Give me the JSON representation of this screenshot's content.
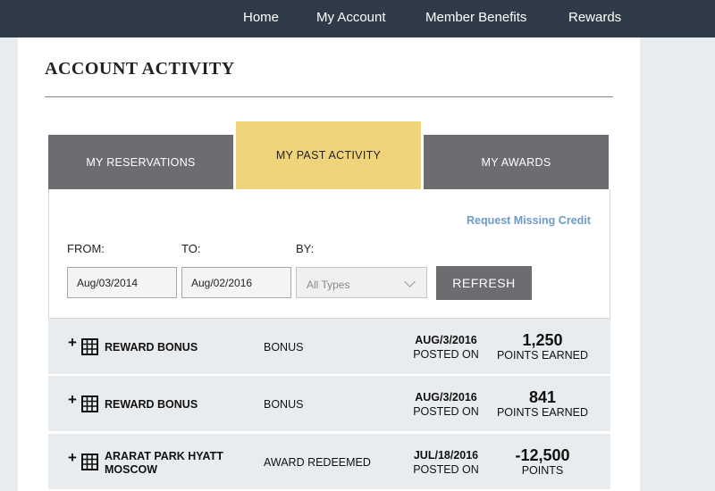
{
  "nav": {
    "items": [
      "Home",
      "My Account",
      "Member Benefits",
      "Rewards"
    ]
  },
  "page_title": "ACCOUNT ACTIVITY",
  "tabs": [
    {
      "label": "MY RESERVATIONS",
      "active": false
    },
    {
      "label": "MY PAST ACTIVITY",
      "active": true
    },
    {
      "label": "MY AWARDS",
      "active": false
    }
  ],
  "filters": {
    "request_link": "Request Missing Credit",
    "from_label": "FROM:",
    "to_label": "TO:",
    "by_label": "BY:",
    "from_value": "Aug/03/2014",
    "to_value": "Aug/02/2016",
    "by_value": "All Types",
    "refresh_label": "REFRESH"
  },
  "activity": [
    {
      "expand": "+",
      "icon": "building-icon",
      "name": "REWARD BONUS",
      "type": "BONUS",
      "date": "AUG/3/2016",
      "date_sub": "POSTED ON",
      "points": "1,250",
      "points_label": "POINTS EARNED"
    },
    {
      "expand": "+",
      "icon": "building-icon",
      "name": "REWARD BONUS",
      "type": "BONUS",
      "date": "AUG/3/2016",
      "date_sub": "POSTED ON",
      "points": "841",
      "points_label": "POINTS EARNED"
    },
    {
      "expand": "+",
      "icon": "building-icon",
      "name": "ARARAT PARK HYATT MOSCOW",
      "type": "AWARD REDEEMED",
      "date": "JUL/18/2016",
      "date_sub": "POSTED ON",
      "points": "-12,500",
      "points_label": "POINTS"
    }
  ],
  "colors": {
    "nav_bg": "#2f3b48",
    "tab_inactive": "#6b6d70",
    "tab_active": "#f0d47c",
    "link": "#6d9bc8",
    "row_bg": "#e9ecef"
  }
}
